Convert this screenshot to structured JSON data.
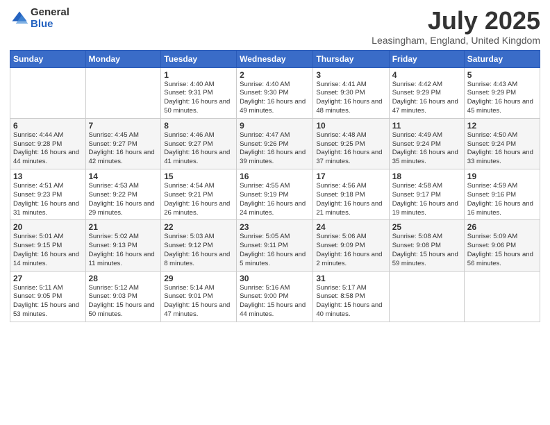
{
  "logo": {
    "general": "General",
    "blue": "Blue"
  },
  "header": {
    "title": "July 2025",
    "subtitle": "Leasingham, England, United Kingdom"
  },
  "days_of_week": [
    "Sunday",
    "Monday",
    "Tuesday",
    "Wednesday",
    "Thursday",
    "Friday",
    "Saturday"
  ],
  "weeks": [
    [
      {
        "day": "",
        "sunrise": "",
        "sunset": "",
        "daylight": ""
      },
      {
        "day": "",
        "sunrise": "",
        "sunset": "",
        "daylight": ""
      },
      {
        "day": "1",
        "sunrise": "Sunrise: 4:40 AM",
        "sunset": "Sunset: 9:31 PM",
        "daylight": "Daylight: 16 hours and 50 minutes."
      },
      {
        "day": "2",
        "sunrise": "Sunrise: 4:40 AM",
        "sunset": "Sunset: 9:30 PM",
        "daylight": "Daylight: 16 hours and 49 minutes."
      },
      {
        "day": "3",
        "sunrise": "Sunrise: 4:41 AM",
        "sunset": "Sunset: 9:30 PM",
        "daylight": "Daylight: 16 hours and 48 minutes."
      },
      {
        "day": "4",
        "sunrise": "Sunrise: 4:42 AM",
        "sunset": "Sunset: 9:29 PM",
        "daylight": "Daylight: 16 hours and 47 minutes."
      },
      {
        "day": "5",
        "sunrise": "Sunrise: 4:43 AM",
        "sunset": "Sunset: 9:29 PM",
        "daylight": "Daylight: 16 hours and 45 minutes."
      }
    ],
    [
      {
        "day": "6",
        "sunrise": "Sunrise: 4:44 AM",
        "sunset": "Sunset: 9:28 PM",
        "daylight": "Daylight: 16 hours and 44 minutes."
      },
      {
        "day": "7",
        "sunrise": "Sunrise: 4:45 AM",
        "sunset": "Sunset: 9:27 PM",
        "daylight": "Daylight: 16 hours and 42 minutes."
      },
      {
        "day": "8",
        "sunrise": "Sunrise: 4:46 AM",
        "sunset": "Sunset: 9:27 PM",
        "daylight": "Daylight: 16 hours and 41 minutes."
      },
      {
        "day": "9",
        "sunrise": "Sunrise: 4:47 AM",
        "sunset": "Sunset: 9:26 PM",
        "daylight": "Daylight: 16 hours and 39 minutes."
      },
      {
        "day": "10",
        "sunrise": "Sunrise: 4:48 AM",
        "sunset": "Sunset: 9:25 PM",
        "daylight": "Daylight: 16 hours and 37 minutes."
      },
      {
        "day": "11",
        "sunrise": "Sunrise: 4:49 AM",
        "sunset": "Sunset: 9:24 PM",
        "daylight": "Daylight: 16 hours and 35 minutes."
      },
      {
        "day": "12",
        "sunrise": "Sunrise: 4:50 AM",
        "sunset": "Sunset: 9:24 PM",
        "daylight": "Daylight: 16 hours and 33 minutes."
      }
    ],
    [
      {
        "day": "13",
        "sunrise": "Sunrise: 4:51 AM",
        "sunset": "Sunset: 9:23 PM",
        "daylight": "Daylight: 16 hours and 31 minutes."
      },
      {
        "day": "14",
        "sunrise": "Sunrise: 4:53 AM",
        "sunset": "Sunset: 9:22 PM",
        "daylight": "Daylight: 16 hours and 29 minutes."
      },
      {
        "day": "15",
        "sunrise": "Sunrise: 4:54 AM",
        "sunset": "Sunset: 9:21 PM",
        "daylight": "Daylight: 16 hours and 26 minutes."
      },
      {
        "day": "16",
        "sunrise": "Sunrise: 4:55 AM",
        "sunset": "Sunset: 9:19 PM",
        "daylight": "Daylight: 16 hours and 24 minutes."
      },
      {
        "day": "17",
        "sunrise": "Sunrise: 4:56 AM",
        "sunset": "Sunset: 9:18 PM",
        "daylight": "Daylight: 16 hours and 21 minutes."
      },
      {
        "day": "18",
        "sunrise": "Sunrise: 4:58 AM",
        "sunset": "Sunset: 9:17 PM",
        "daylight": "Daylight: 16 hours and 19 minutes."
      },
      {
        "day": "19",
        "sunrise": "Sunrise: 4:59 AM",
        "sunset": "Sunset: 9:16 PM",
        "daylight": "Daylight: 16 hours and 16 minutes."
      }
    ],
    [
      {
        "day": "20",
        "sunrise": "Sunrise: 5:01 AM",
        "sunset": "Sunset: 9:15 PM",
        "daylight": "Daylight: 16 hours and 14 minutes."
      },
      {
        "day": "21",
        "sunrise": "Sunrise: 5:02 AM",
        "sunset": "Sunset: 9:13 PM",
        "daylight": "Daylight: 16 hours and 11 minutes."
      },
      {
        "day": "22",
        "sunrise": "Sunrise: 5:03 AM",
        "sunset": "Sunset: 9:12 PM",
        "daylight": "Daylight: 16 hours and 8 minutes."
      },
      {
        "day": "23",
        "sunrise": "Sunrise: 5:05 AM",
        "sunset": "Sunset: 9:11 PM",
        "daylight": "Daylight: 16 hours and 5 minutes."
      },
      {
        "day": "24",
        "sunrise": "Sunrise: 5:06 AM",
        "sunset": "Sunset: 9:09 PM",
        "daylight": "Daylight: 16 hours and 2 minutes."
      },
      {
        "day": "25",
        "sunrise": "Sunrise: 5:08 AM",
        "sunset": "Sunset: 9:08 PM",
        "daylight": "Daylight: 15 hours and 59 minutes."
      },
      {
        "day": "26",
        "sunrise": "Sunrise: 5:09 AM",
        "sunset": "Sunset: 9:06 PM",
        "daylight": "Daylight: 15 hours and 56 minutes."
      }
    ],
    [
      {
        "day": "27",
        "sunrise": "Sunrise: 5:11 AM",
        "sunset": "Sunset: 9:05 PM",
        "daylight": "Daylight: 15 hours and 53 minutes."
      },
      {
        "day": "28",
        "sunrise": "Sunrise: 5:12 AM",
        "sunset": "Sunset: 9:03 PM",
        "daylight": "Daylight: 15 hours and 50 minutes."
      },
      {
        "day": "29",
        "sunrise": "Sunrise: 5:14 AM",
        "sunset": "Sunset: 9:01 PM",
        "daylight": "Daylight: 15 hours and 47 minutes."
      },
      {
        "day": "30",
        "sunrise": "Sunrise: 5:16 AM",
        "sunset": "Sunset: 9:00 PM",
        "daylight": "Daylight: 15 hours and 44 minutes."
      },
      {
        "day": "31",
        "sunrise": "Sunrise: 5:17 AM",
        "sunset": "Sunset: 8:58 PM",
        "daylight": "Daylight: 15 hours and 40 minutes."
      },
      {
        "day": "",
        "sunrise": "",
        "sunset": "",
        "daylight": ""
      },
      {
        "day": "",
        "sunrise": "",
        "sunset": "",
        "daylight": ""
      }
    ]
  ]
}
